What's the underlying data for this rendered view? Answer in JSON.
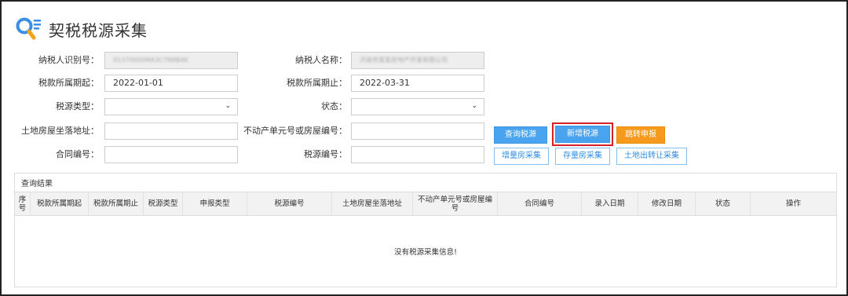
{
  "header": {
    "title": "契税税源采集"
  },
  "form": {
    "taxpayer_id": {
      "label": "纳税人识别号：",
      "value": "91370000MA3C7N8B4K"
    },
    "taxpayer_name": {
      "label": "纳税人名称：",
      "value": "济南市某某房地产开发有限公司"
    },
    "period_start": {
      "label": "税款所属期起：",
      "value": "2022-01-01"
    },
    "period_end": {
      "label": "税款所属期止：",
      "value": "2022-03-31"
    },
    "source_type": {
      "label": "税源类型：",
      "value": ""
    },
    "status": {
      "label": "状态：",
      "value": ""
    },
    "land_address": {
      "label": "土地房屋坐落地址：",
      "value": ""
    },
    "property_unit_no": {
      "label": "不动产单元号或房屋编号：",
      "value": ""
    },
    "contract_no": {
      "label": "合同编号：",
      "value": ""
    },
    "source_no": {
      "label": "税源编号：",
      "value": ""
    }
  },
  "buttons": {
    "query": "查询税源",
    "add": "新增税源",
    "jump": "跳转申报",
    "incremental": "增量房采集",
    "existing": "存量房采集",
    "land_transfer": "土地出转让采集"
  },
  "results": {
    "title": "查询结果",
    "columns": [
      "序号",
      "税款所属期起",
      "税款所属期止",
      "税源类型",
      "申报类型",
      "税源编号",
      "土地房屋坐落地址",
      "不动产单元号或房屋编号",
      "合同编号",
      "录入日期",
      "修改日期",
      "状态",
      "操作"
    ],
    "empty_text": "没有税源采集信息!"
  },
  "colors": {
    "accent_blue": "#4aa3ee",
    "orange": "#f59a1d",
    "highlight_red": "#d52027"
  }
}
